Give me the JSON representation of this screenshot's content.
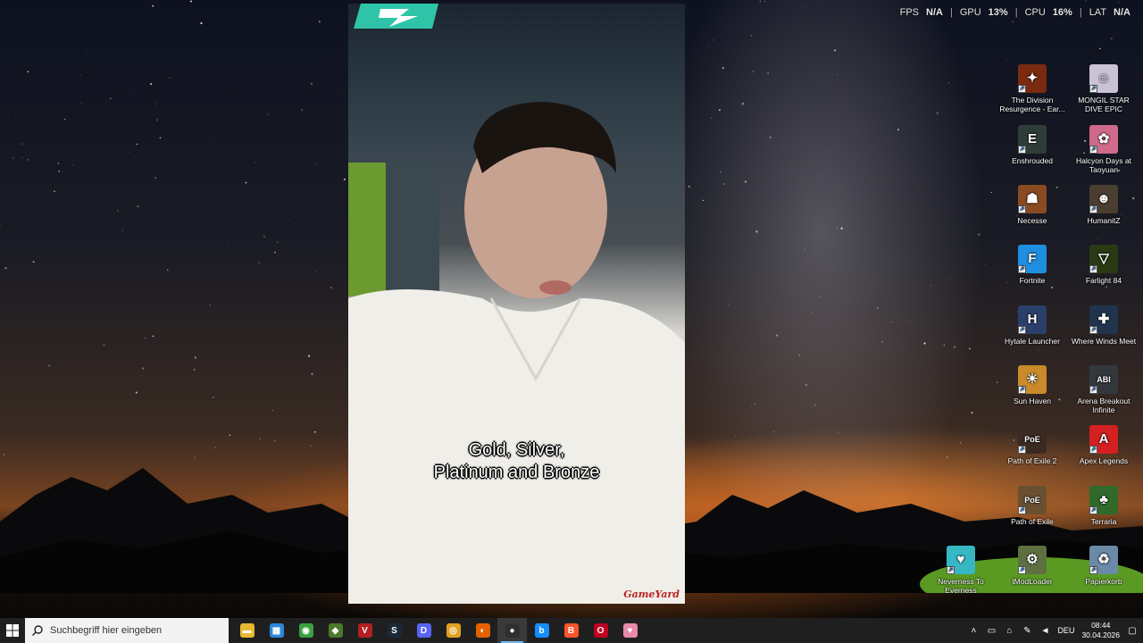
{
  "hud": {
    "fps_label": "FPS",
    "fps_value": "N/A",
    "gpu_label": "GPU",
    "gpu_value": "13%",
    "cpu_label": "CPU",
    "cpu_value": "16%",
    "lat_label": "LAT",
    "lat_value": "N/A",
    "separator": "|"
  },
  "video": {
    "caption_line1": "Gold, Silver,",
    "caption_line2": "Platinum and Bronze",
    "watermark": "GameYard"
  },
  "desktop_icons": [
    {
      "label": "The Division Resurgence - Ear...",
      "name": "the-division-resurgence-icon",
      "color": "#7a2a10",
      "glyph": "✦"
    },
    {
      "label": "MONGIL STAR DIVE EPIC",
      "name": "mongil-star-dive-icon",
      "color": "#c9c2d6",
      "glyph": "☺"
    },
    {
      "label": "Enshrouded",
      "name": "enshrouded-icon",
      "color": "#2e3d36",
      "glyph": "E"
    },
    {
      "label": "Halcyon Days at Taoyuan",
      "name": "halcyon-days-icon",
      "color": "#d06a8a",
      "glyph": "✿"
    },
    {
      "label": "Necesse",
      "name": "necesse-icon",
      "color": "#8a4a22",
      "glyph": "☗"
    },
    {
      "label": "HumanitZ",
      "name": "humanitz-icon",
      "color": "#4a3e30",
      "glyph": "☻"
    },
    {
      "label": "Fortnite",
      "name": "fortnite-icon",
      "color": "#1e8fe0",
      "glyph": "F"
    },
    {
      "label": "Farlight 84",
      "name": "farlight-84-icon",
      "color": "#2b3a14",
      "glyph": "▽"
    },
    {
      "label": "Hytale Launcher",
      "name": "hytale-launcher-icon",
      "color": "#2a3f6a",
      "glyph": "H"
    },
    {
      "label": "Where Winds Meet",
      "name": "where-winds-meet-icon",
      "color": "#21344e",
      "glyph": "✚"
    },
    {
      "label": "Sun Haven",
      "name": "sun-haven-icon",
      "color": "#c98a2a",
      "glyph": "☀"
    },
    {
      "label": "Arena Breakout Infinite",
      "name": "arena-breakout-icon",
      "color": "#33383c",
      "glyph": "ABI"
    },
    {
      "label": "Path of Exile 2",
      "name": "path-of-exile-2-icon",
      "color": "#3a2a22",
      "glyph": "PoE"
    },
    {
      "label": "Apex Legends",
      "name": "apex-legends-icon",
      "color": "#d42020",
      "glyph": "A"
    },
    {
      "label": "Path of Exile",
      "name": "path-of-exile-icon",
      "color": "#6a5030",
      "glyph": "PoE"
    },
    {
      "label": "Terraria",
      "name": "terraria-icon",
      "color": "#2f6a2a",
      "glyph": "♣"
    },
    {
      "label": "Neverness To Everness",
      "name": "neverness-to-everness-icon",
      "color": "#35b7c4",
      "glyph": "♥"
    },
    {
      "label": "tModLoader",
      "name": "tmodloader-icon",
      "color": "#5e7040",
      "glyph": "⚙"
    },
    {
      "label": "Papierkorb",
      "name": "recycle-bin-icon",
      "color": "#6a8aa8",
      "glyph": "♻"
    }
  ],
  "taskbar": {
    "search_placeholder": "Suchbegriff hier eingeben",
    "apps": [
      {
        "name": "file-explorer-icon",
        "color": "#e8b830",
        "glyph": "▬"
      },
      {
        "name": "microsoft-store-icon",
        "color": "#2b88d8",
        "glyph": "▦"
      },
      {
        "name": "nvidia-app-icon",
        "color": "#3aa040",
        "glyph": "◉"
      },
      {
        "name": "minecraft-launcher-icon",
        "color": "#4a7a2a",
        "glyph": "◆"
      },
      {
        "name": "voicemeeter-icon",
        "color": "#b02020",
        "glyph": "V"
      },
      {
        "name": "steam-icon",
        "color": "#1b2838",
        "glyph": "S"
      },
      {
        "name": "discord-icon",
        "color": "#5865f2",
        "glyph": "D"
      },
      {
        "name": "chrome-icon",
        "color": "#e0a020",
        "glyph": "◎"
      },
      {
        "name": "firefox-icon",
        "color": "#e66000",
        "glyph": "◐"
      },
      {
        "name": "obs-studio-icon",
        "color": "#302e31",
        "glyph": "●"
      },
      {
        "name": "battlenet-icon",
        "color": "#148eff",
        "glyph": "b"
      },
      {
        "name": "brave-icon",
        "color": "#fb542b",
        "glyph": "B"
      },
      {
        "name": "opera-gx-icon",
        "color": "#c00020",
        "glyph": "O"
      },
      {
        "name": "image-viewer-icon",
        "color": "#e88aa8",
        "glyph": "♥"
      }
    ],
    "tray": {
      "language": "DEU",
      "time": "08:44",
      "date": "30.04.2026"
    }
  },
  "colors": {
    "taskbar_bg": "#1f1f1f",
    "search_bg": "#f3f3f3",
    "active_indicator": "#76b9ed"
  }
}
